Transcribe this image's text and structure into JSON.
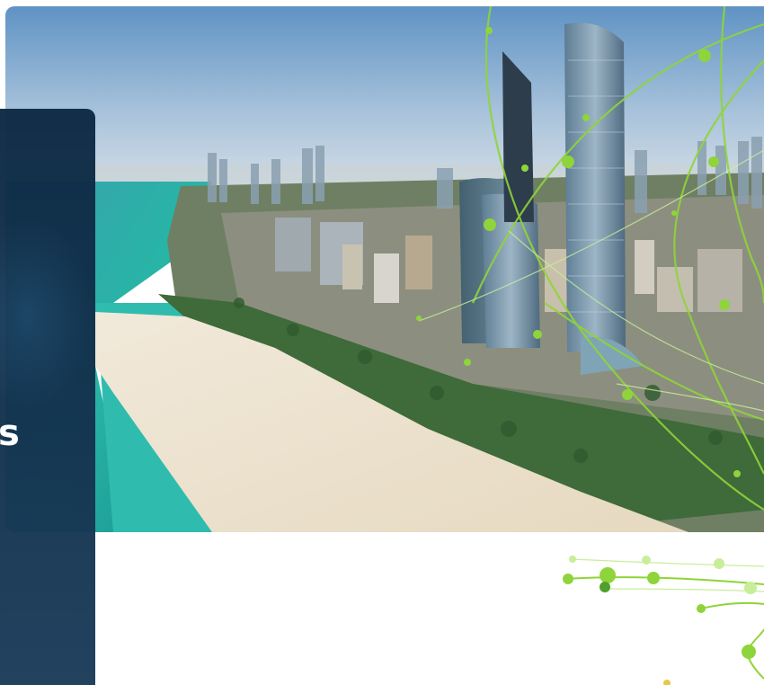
{
  "hero": {
    "image_subject": "aerial-city-coastline-photo",
    "colors": {
      "sky_top": "#6f9fcb",
      "sky_horizon": "#c7d6e2",
      "sea": "#2ab3a8",
      "sand": "#ece3d2",
      "accent_green": "#8fd43a"
    }
  },
  "side_panel": {
    "heading_visible": "s",
    "color": "#0e2a44"
  }
}
